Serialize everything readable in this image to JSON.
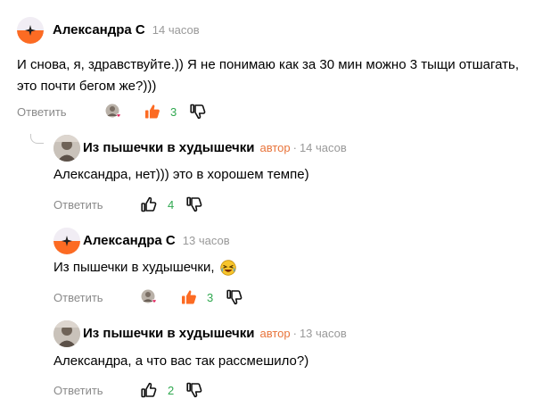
{
  "comments": [
    {
      "author": "Александра С",
      "time": "14 часов",
      "text_lines": [
        "И снова, я, здравствуйте.)) Я не понимаю как за 30 мин можно 3 тыщи отшагать,",
        "это почти бегом же?)))"
      ],
      "reply_label": "Ответить",
      "likes": "3"
    },
    {
      "author": "Из пышечки в худышечки",
      "badge": "автор",
      "separator": "·",
      "time": "14 часов",
      "text_lines": [
        "Александра, нет))) это в хорошем темпе)"
      ],
      "reply_label": "Ответить",
      "likes": "4"
    },
    {
      "author": "Александра С",
      "time": "13 часов",
      "text_lines": [
        "Из пышечки в худышечки,"
      ],
      "reply_label": "Ответить",
      "likes": "3"
    },
    {
      "author": "Из пышечки в худышечки",
      "badge": "автор",
      "separator": "·",
      "time": "13 часов",
      "text_lines": [
        "Александра, а что вас так рассмешило?)"
      ],
      "reply_label": "Ответить",
      "likes": "2"
    }
  ],
  "icons": {
    "like": "thumbs-up-icon",
    "dislike": "thumbs-down-icon",
    "liked": "thumbs-up-filled-icon",
    "author_liked": "author-avatar-heart-icon",
    "emoji": "laughing-emoji-icon",
    "thread": "reply-thread-line-icon"
  },
  "colors": {
    "accent_orange": "#fc6b23",
    "count_green": "#2fa84f",
    "author_badge": "#e8743b",
    "muted_text": "#8a8a8a",
    "heart": "#e0245e"
  }
}
